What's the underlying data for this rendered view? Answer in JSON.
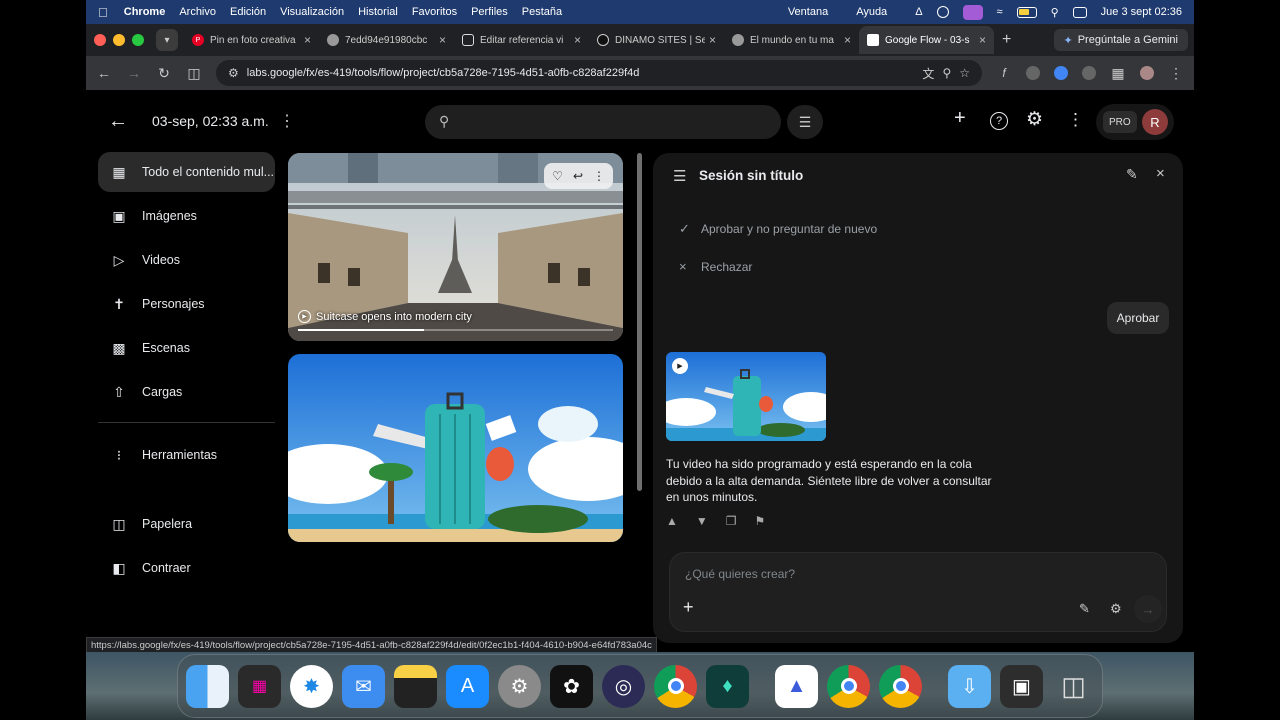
{
  "menubar": {
    "app": "Chrome",
    "items": [
      "Archivo",
      "Edición",
      "Visualización",
      "Historial",
      "Favoritos",
      "Perfiles",
      "Pestaña"
    ],
    "right_items": [
      "Ventana",
      "Ayuda"
    ],
    "datetime": "Jue 3 sept  02:36"
  },
  "tabs": [
    {
      "title": "Pin en foto creativa",
      "icon": "pinterest-icon"
    },
    {
      "title": "7edd94e91980cbc",
      "icon": "globe-icon"
    },
    {
      "title": "Editar referencia vi",
      "icon": "instagram-icon"
    },
    {
      "title": "DÍNAMO SITES | Se",
      "icon": "dinamo-icon"
    },
    {
      "title": "El mundo en tu ma",
      "icon": "globe-icon"
    },
    {
      "title": "Google Flow - 03-s",
      "icon": "doc-icon",
      "active": true
    }
  ],
  "gemini_label": "Pregúntale a Gemini",
  "address": {
    "url": "labs.google/fx/es-419/tools/flow/project/cb5a728e-7195-4d51-a0fb-c828af229f4d"
  },
  "header": {
    "title": "03-sep, 02:33 a.m.",
    "search_placeholder": "",
    "pro_label": "PRO",
    "avatar_initial": "R"
  },
  "leftnav": {
    "items": [
      {
        "label": "Todo el contenido mul...",
        "icon": "grid-icon",
        "selected": true
      },
      {
        "label": "Imágenes",
        "icon": "image-icon"
      },
      {
        "label": "Videos",
        "icon": "video-icon"
      },
      {
        "label": "Personajes",
        "icon": "person-icon"
      },
      {
        "label": "Escenas",
        "icon": "clapper-icon"
      },
      {
        "label": "Cargas",
        "icon": "upload-folder-icon"
      }
    ],
    "tools_label": "Herramientas",
    "trash_label": "Papelera",
    "collapse_label": "Contraer"
  },
  "media": {
    "cards": [
      {
        "caption": "Suitcase opens into modern city",
        "progress": 0.4
      },
      {
        "caption": ""
      }
    ]
  },
  "panel": {
    "title": "Sesión sin título",
    "option_approve_all": "Aprobar y no preguntar de nuevo",
    "option_reject": "Rechazar",
    "approve_button": "Aprobar",
    "message": "Tu video ha sido programado y está esperando en la cola debido a la alta demanda. Siéntete libre de volver a consultar en unos minutos.",
    "composer_placeholder": "¿Qué quieres crear?"
  },
  "status_url": "https://labs.google/fx/es-419/tools/flow/project/cb5a728e-7195-4d51-a0fb-c828af229f4d/edit/0f2ec1b1-f404-4610-b904-e64fd783a04c",
  "dock": {
    "apps": [
      "finder-icon",
      "launchpad-icon",
      "safari-icon",
      "mail-icon",
      "notes-icon",
      "app-store-icon",
      "system-settings-icon",
      "chatgpt-icon",
      "obs-icon",
      "chrome-icon",
      "filmora-icon",
      "arc-icon",
      "chrome-icon",
      "chrome-icon",
      "downloads-folder-icon",
      "screen-icon",
      "trash-icon"
    ]
  },
  "colors": {
    "accent": "#8ab4f8",
    "panel_bg": "#161616",
    "menubar_bg": "#1f3a6e"
  }
}
